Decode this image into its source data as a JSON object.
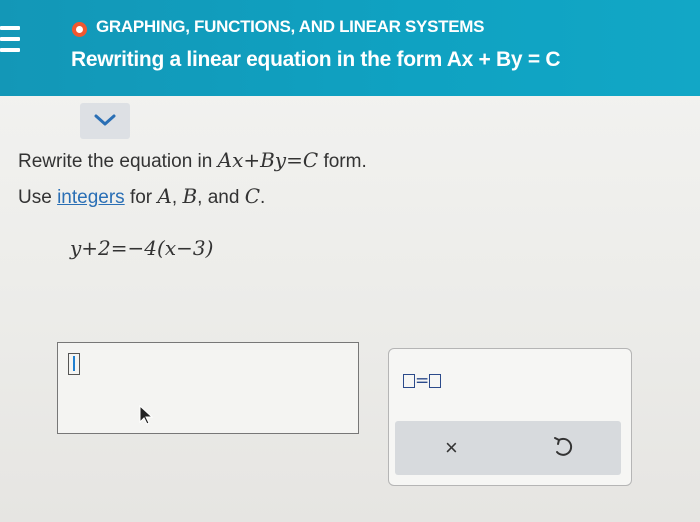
{
  "header": {
    "topic": "GRAPHING, FUNCTIONS, AND LINEAR SYSTEMS",
    "title": "Rewriting a linear equation in the form Ax + By = C"
  },
  "instructions": {
    "line1_prefix": "Rewrite the equation in ",
    "line1_math": "Ax+By=C",
    "line1_suffix": " form.",
    "line2_prefix": "Use ",
    "line2_link": "integers",
    "line2_mid1": " for ",
    "var_a": "A",
    "sep1": ", ",
    "var_b": "B",
    "sep2": ", and ",
    "var_c": "C",
    "end": "."
  },
  "equation": "y+2=−4(x−3)",
  "keypad": {
    "template_equals": "=",
    "clear_symbol": "×"
  },
  "colors": {
    "header_bg": "#12a0c0",
    "status_ring": "#f0582f",
    "link": "#2a6fb5"
  },
  "icons": [
    "menu-icon",
    "status-icon",
    "chevron-down-icon",
    "text-caret-icon",
    "pointer-cursor-icon",
    "undo-icon"
  ]
}
